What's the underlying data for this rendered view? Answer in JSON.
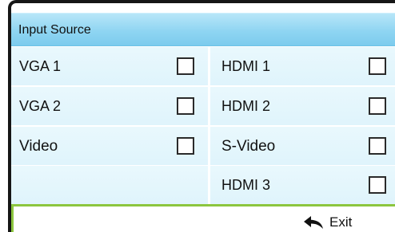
{
  "menu": {
    "title": "Input Source"
  },
  "sources": {
    "left": [
      {
        "label": "VGA 1",
        "checked": false
      },
      {
        "label": "VGA 2",
        "checked": false
      },
      {
        "label": "Video",
        "checked": false
      }
    ],
    "right": [
      {
        "label": "HDMI 1",
        "checked": false
      },
      {
        "label": "HDMI 2",
        "checked": false
      },
      {
        "label": "S-Video",
        "checked": false
      },
      {
        "label": "HDMI 3",
        "checked": false
      }
    ]
  },
  "footer": {
    "exit_label": "Exit",
    "exit_icon": "return-arrow-icon"
  },
  "colors": {
    "title_bar": "#8fd5f2",
    "cell_background": "#e3f5fc",
    "footer_border": "#8cc63f",
    "frame_border": "#161616"
  }
}
